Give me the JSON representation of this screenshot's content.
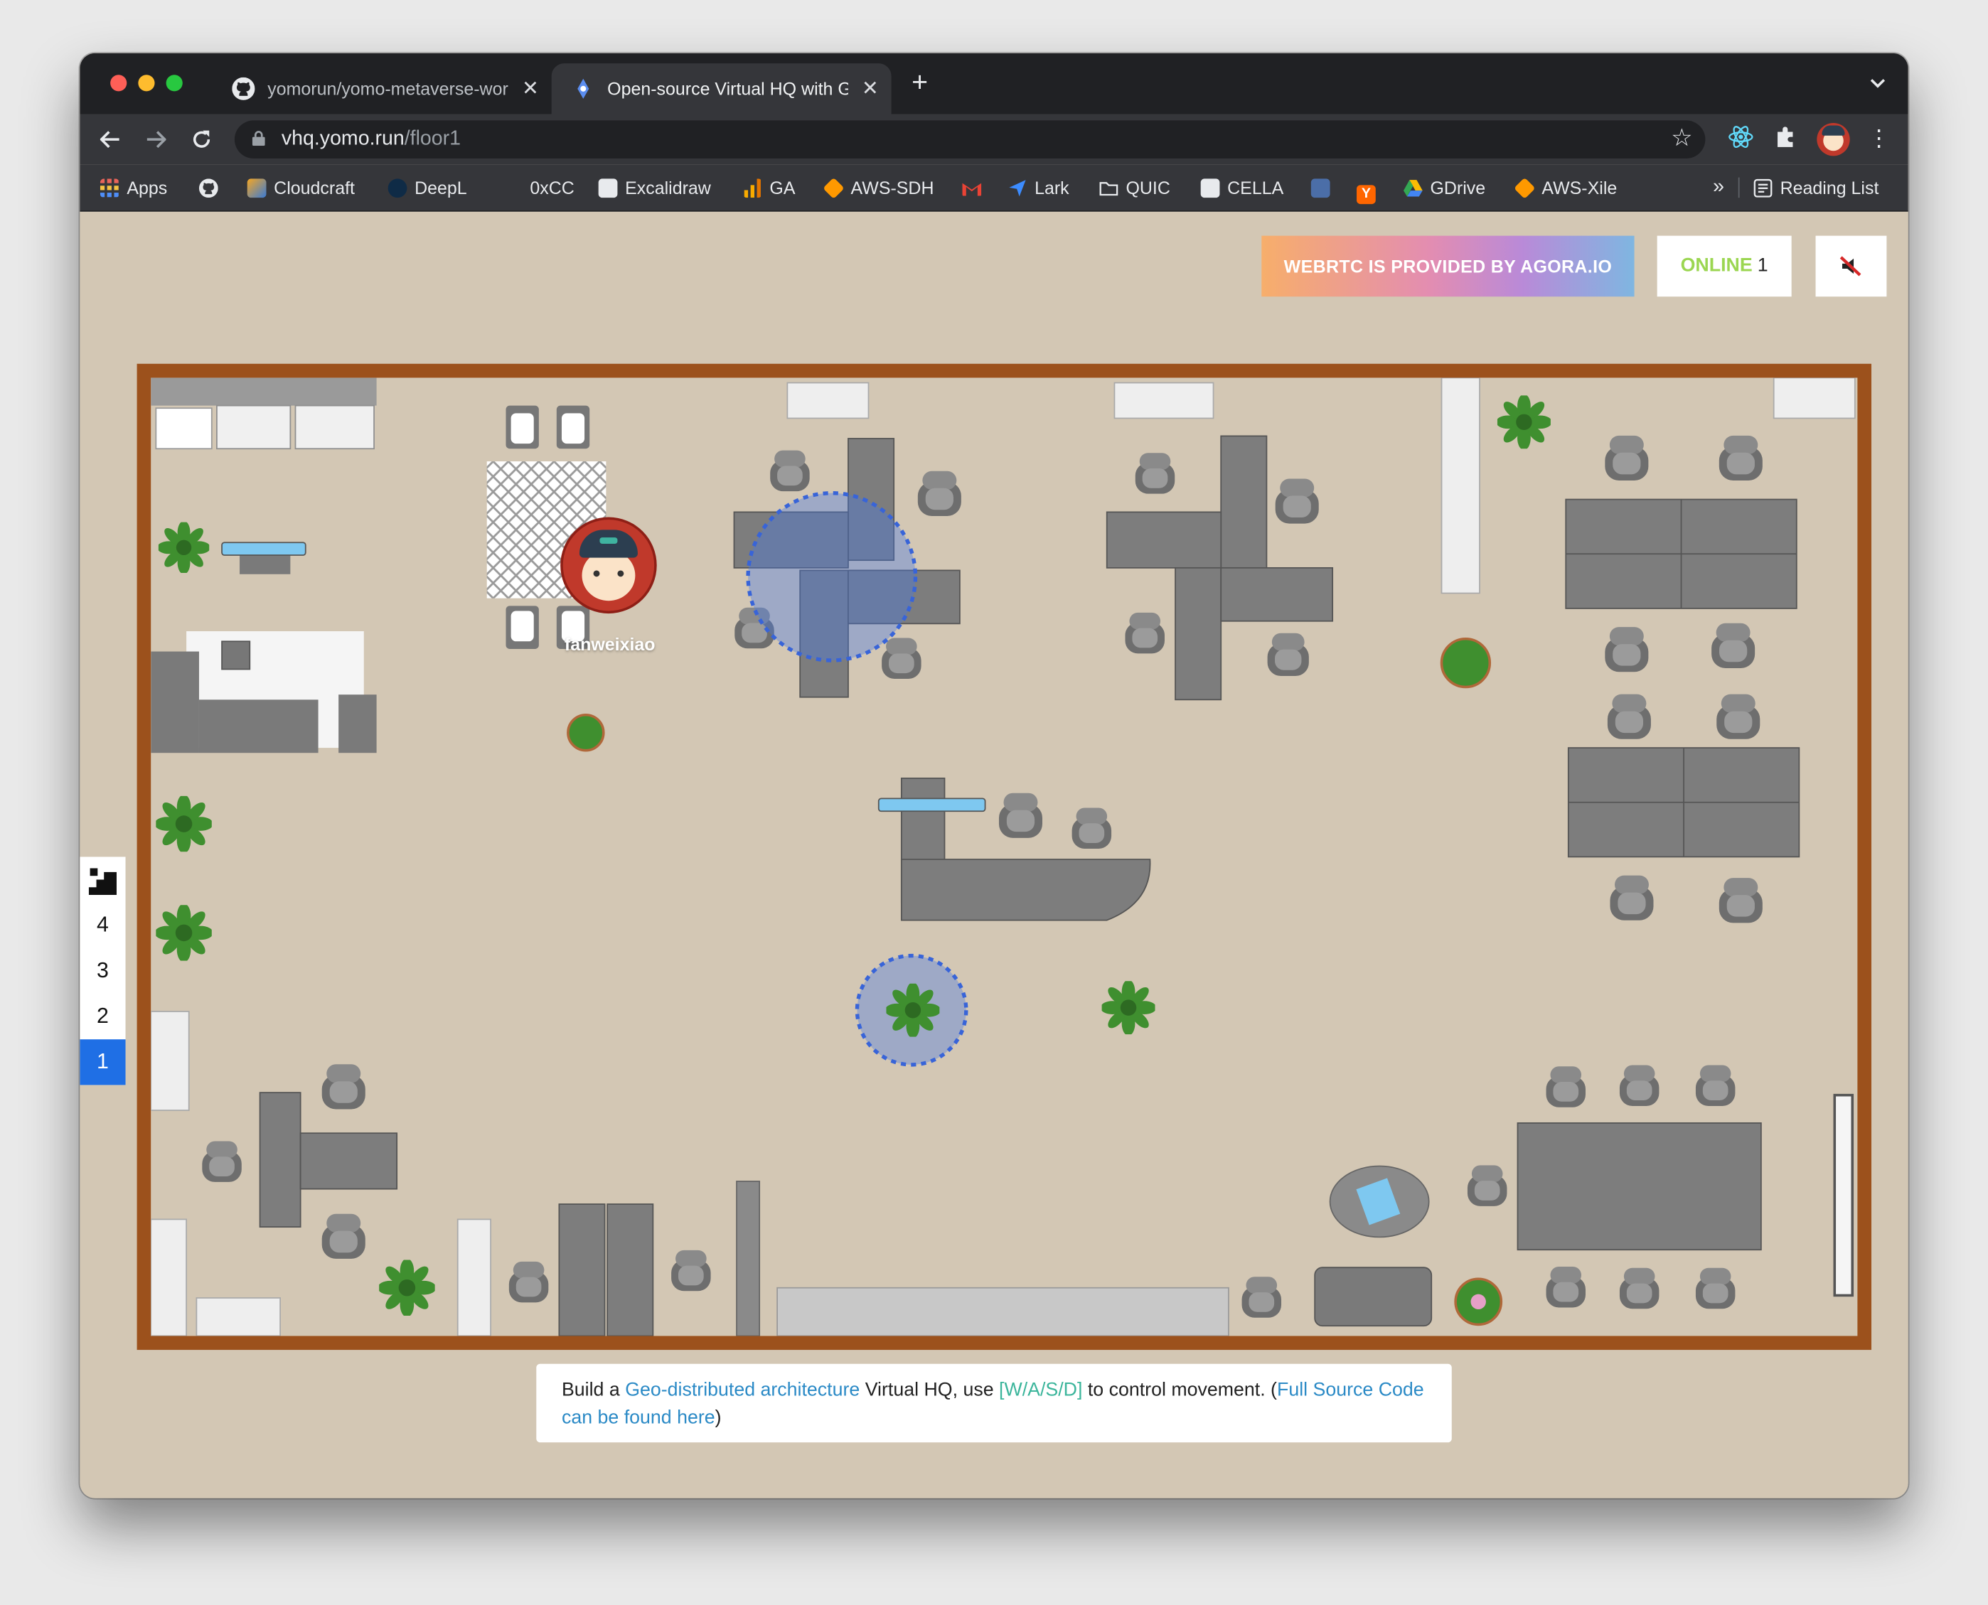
{
  "browser": {
    "tabs": [
      {
        "label": "yomorun/yomo-metaverse-wor",
        "icon": "github-icon"
      },
      {
        "label": "Open-source Virtual HQ with G",
        "icon": "yomo-icon"
      }
    ],
    "new_tab": "+",
    "address": {
      "host": "vhq.yomo.run",
      "path": "/floor1"
    },
    "bookmarks": [
      {
        "label": "Apps",
        "icon": "apps-grid-icon"
      },
      {
        "label": "",
        "icon": "github-icon"
      },
      {
        "label": "Cloudcraft",
        "icon": "cloudcraft-icon"
      },
      {
        "label": "DeepL",
        "icon": "deepl-icon"
      },
      {
        "label": "0xCC",
        "icon": ""
      },
      {
        "label": "Excalidraw",
        "icon": "excalidraw-icon"
      },
      {
        "label": "GA",
        "icon": "analytics-icon"
      },
      {
        "label": "AWS-SDH",
        "icon": "aws-icon"
      },
      {
        "label": "",
        "icon": "gmail-icon"
      },
      {
        "label": "Lark",
        "icon": "lark-icon"
      },
      {
        "label": "QUIC",
        "icon": "folder-icon"
      },
      {
        "label": "CELLA",
        "icon": "cella-icon"
      },
      {
        "label": "",
        "icon": "doc-icon"
      },
      {
        "label": "",
        "icon": "ycombinator-icon"
      },
      {
        "label": "GDrive",
        "icon": "gdrive-icon"
      },
      {
        "label": "AWS-Xile",
        "icon": "aws-icon"
      }
    ],
    "more_bookmarks": "»",
    "reading_list": "Reading List"
  },
  "page": {
    "agora_banner": "WEBRTC IS PROVIDED BY AGORA.IO",
    "online": {
      "label": "ONLINE",
      "count": "1"
    },
    "floors": [
      "4",
      "3",
      "2",
      "1"
    ],
    "active_floor": "1",
    "player": {
      "name": "fanweixiao"
    },
    "footer": {
      "t1": "Build a ",
      "link1": "Geo-distributed architecture",
      "t2": " Virtual HQ, use ",
      "keys": "[W/A/S/D]",
      "t3": " to control movement.  (",
      "link2": "Full Source Code can be found here",
      "t4": ")"
    }
  },
  "colors": {
    "floor": "#d3c7b4",
    "wall": "#9c511c",
    "active_floor": "#1f6fe5",
    "online_green": "#9bd651",
    "link": "#2b8ac6"
  }
}
